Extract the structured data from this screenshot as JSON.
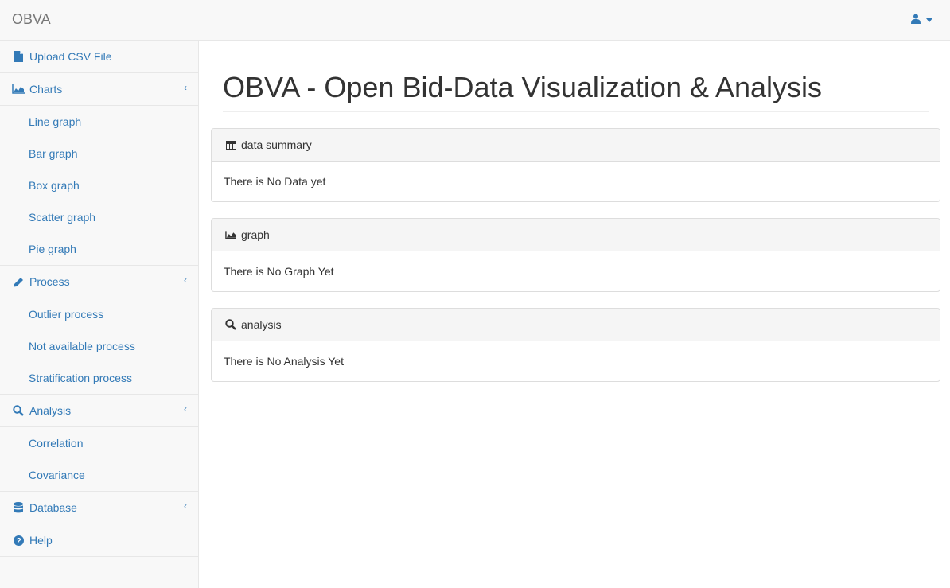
{
  "navbar": {
    "brand": "OBVA",
    "user_icon": "user-icon"
  },
  "sidebar": {
    "upload": {
      "label": "Upload CSV File",
      "icon": "file-icon"
    },
    "charts": {
      "label": "Charts",
      "icon": "area-chart-icon",
      "items": [
        "Line graph",
        "Bar graph",
        "Box graph",
        "Scatter graph",
        "Pie graph"
      ]
    },
    "process": {
      "label": "Process",
      "icon": "pencil-icon",
      "items": [
        "Outlier process",
        "Not available process",
        "Stratification process"
      ]
    },
    "analysis": {
      "label": "Analysis",
      "icon": "search-icon",
      "items": [
        "Correlation",
        "Covariance"
      ]
    },
    "database": {
      "label": "Database",
      "icon": "database-icon"
    },
    "help": {
      "label": "Help",
      "icon": "question-circle-icon"
    },
    "chevron": "‹"
  },
  "main": {
    "title": "OBVA - Open Bid-Data Visualization & Analysis",
    "panels": [
      {
        "heading": "data summary",
        "icon": "table-icon",
        "body": "There is No Data yet"
      },
      {
        "heading": "graph",
        "icon": "area-chart-icon",
        "body": "There is No Graph Yet"
      },
      {
        "heading": "analysis",
        "icon": "search-icon",
        "body": "There is No Analysis Yet"
      }
    ]
  },
  "colors": {
    "link": "#337ab7",
    "navbar_bg": "#f8f8f8",
    "border": "#e7e7e7"
  }
}
